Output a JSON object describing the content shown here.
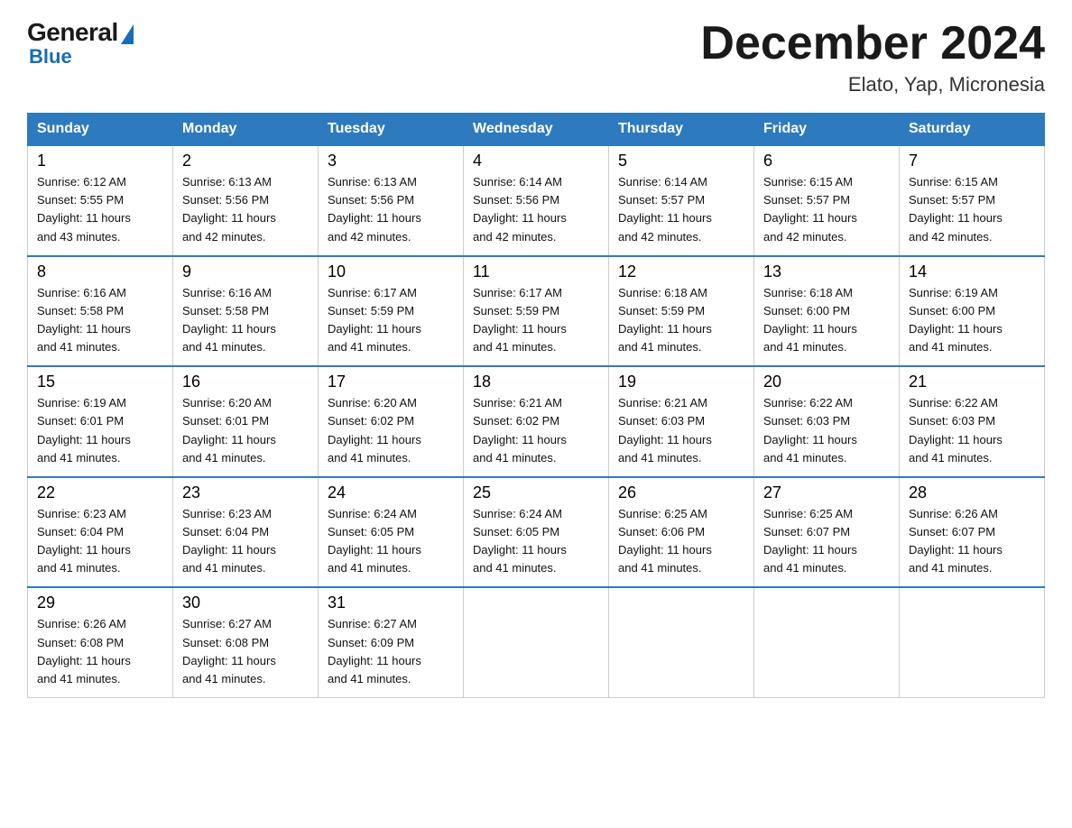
{
  "logo": {
    "general": "General",
    "blue": "Blue"
  },
  "title": "December 2024",
  "location": "Elato, Yap, Micronesia",
  "days_of_week": [
    "Sunday",
    "Monday",
    "Tuesday",
    "Wednesday",
    "Thursday",
    "Friday",
    "Saturday"
  ],
  "weeks": [
    [
      {
        "day": "1",
        "info": "Sunrise: 6:12 AM\nSunset: 5:55 PM\nDaylight: 11 hours\nand 43 minutes."
      },
      {
        "day": "2",
        "info": "Sunrise: 6:13 AM\nSunset: 5:56 PM\nDaylight: 11 hours\nand 42 minutes."
      },
      {
        "day": "3",
        "info": "Sunrise: 6:13 AM\nSunset: 5:56 PM\nDaylight: 11 hours\nand 42 minutes."
      },
      {
        "day": "4",
        "info": "Sunrise: 6:14 AM\nSunset: 5:56 PM\nDaylight: 11 hours\nand 42 minutes."
      },
      {
        "day": "5",
        "info": "Sunrise: 6:14 AM\nSunset: 5:57 PM\nDaylight: 11 hours\nand 42 minutes."
      },
      {
        "day": "6",
        "info": "Sunrise: 6:15 AM\nSunset: 5:57 PM\nDaylight: 11 hours\nand 42 minutes."
      },
      {
        "day": "7",
        "info": "Sunrise: 6:15 AM\nSunset: 5:57 PM\nDaylight: 11 hours\nand 42 minutes."
      }
    ],
    [
      {
        "day": "8",
        "info": "Sunrise: 6:16 AM\nSunset: 5:58 PM\nDaylight: 11 hours\nand 41 minutes."
      },
      {
        "day": "9",
        "info": "Sunrise: 6:16 AM\nSunset: 5:58 PM\nDaylight: 11 hours\nand 41 minutes."
      },
      {
        "day": "10",
        "info": "Sunrise: 6:17 AM\nSunset: 5:59 PM\nDaylight: 11 hours\nand 41 minutes."
      },
      {
        "day": "11",
        "info": "Sunrise: 6:17 AM\nSunset: 5:59 PM\nDaylight: 11 hours\nand 41 minutes."
      },
      {
        "day": "12",
        "info": "Sunrise: 6:18 AM\nSunset: 5:59 PM\nDaylight: 11 hours\nand 41 minutes."
      },
      {
        "day": "13",
        "info": "Sunrise: 6:18 AM\nSunset: 6:00 PM\nDaylight: 11 hours\nand 41 minutes."
      },
      {
        "day": "14",
        "info": "Sunrise: 6:19 AM\nSunset: 6:00 PM\nDaylight: 11 hours\nand 41 minutes."
      }
    ],
    [
      {
        "day": "15",
        "info": "Sunrise: 6:19 AM\nSunset: 6:01 PM\nDaylight: 11 hours\nand 41 minutes."
      },
      {
        "day": "16",
        "info": "Sunrise: 6:20 AM\nSunset: 6:01 PM\nDaylight: 11 hours\nand 41 minutes."
      },
      {
        "day": "17",
        "info": "Sunrise: 6:20 AM\nSunset: 6:02 PM\nDaylight: 11 hours\nand 41 minutes."
      },
      {
        "day": "18",
        "info": "Sunrise: 6:21 AM\nSunset: 6:02 PM\nDaylight: 11 hours\nand 41 minutes."
      },
      {
        "day": "19",
        "info": "Sunrise: 6:21 AM\nSunset: 6:03 PM\nDaylight: 11 hours\nand 41 minutes."
      },
      {
        "day": "20",
        "info": "Sunrise: 6:22 AM\nSunset: 6:03 PM\nDaylight: 11 hours\nand 41 minutes."
      },
      {
        "day": "21",
        "info": "Sunrise: 6:22 AM\nSunset: 6:03 PM\nDaylight: 11 hours\nand 41 minutes."
      }
    ],
    [
      {
        "day": "22",
        "info": "Sunrise: 6:23 AM\nSunset: 6:04 PM\nDaylight: 11 hours\nand 41 minutes."
      },
      {
        "day": "23",
        "info": "Sunrise: 6:23 AM\nSunset: 6:04 PM\nDaylight: 11 hours\nand 41 minutes."
      },
      {
        "day": "24",
        "info": "Sunrise: 6:24 AM\nSunset: 6:05 PM\nDaylight: 11 hours\nand 41 minutes."
      },
      {
        "day": "25",
        "info": "Sunrise: 6:24 AM\nSunset: 6:05 PM\nDaylight: 11 hours\nand 41 minutes."
      },
      {
        "day": "26",
        "info": "Sunrise: 6:25 AM\nSunset: 6:06 PM\nDaylight: 11 hours\nand 41 minutes."
      },
      {
        "day": "27",
        "info": "Sunrise: 6:25 AM\nSunset: 6:07 PM\nDaylight: 11 hours\nand 41 minutes."
      },
      {
        "day": "28",
        "info": "Sunrise: 6:26 AM\nSunset: 6:07 PM\nDaylight: 11 hours\nand 41 minutes."
      }
    ],
    [
      {
        "day": "29",
        "info": "Sunrise: 6:26 AM\nSunset: 6:08 PM\nDaylight: 11 hours\nand 41 minutes."
      },
      {
        "day": "30",
        "info": "Sunrise: 6:27 AM\nSunset: 6:08 PM\nDaylight: 11 hours\nand 41 minutes."
      },
      {
        "day": "31",
        "info": "Sunrise: 6:27 AM\nSunset: 6:09 PM\nDaylight: 11 hours\nand 41 minutes."
      },
      {
        "day": "",
        "info": ""
      },
      {
        "day": "",
        "info": ""
      },
      {
        "day": "",
        "info": ""
      },
      {
        "day": "",
        "info": ""
      }
    ]
  ]
}
